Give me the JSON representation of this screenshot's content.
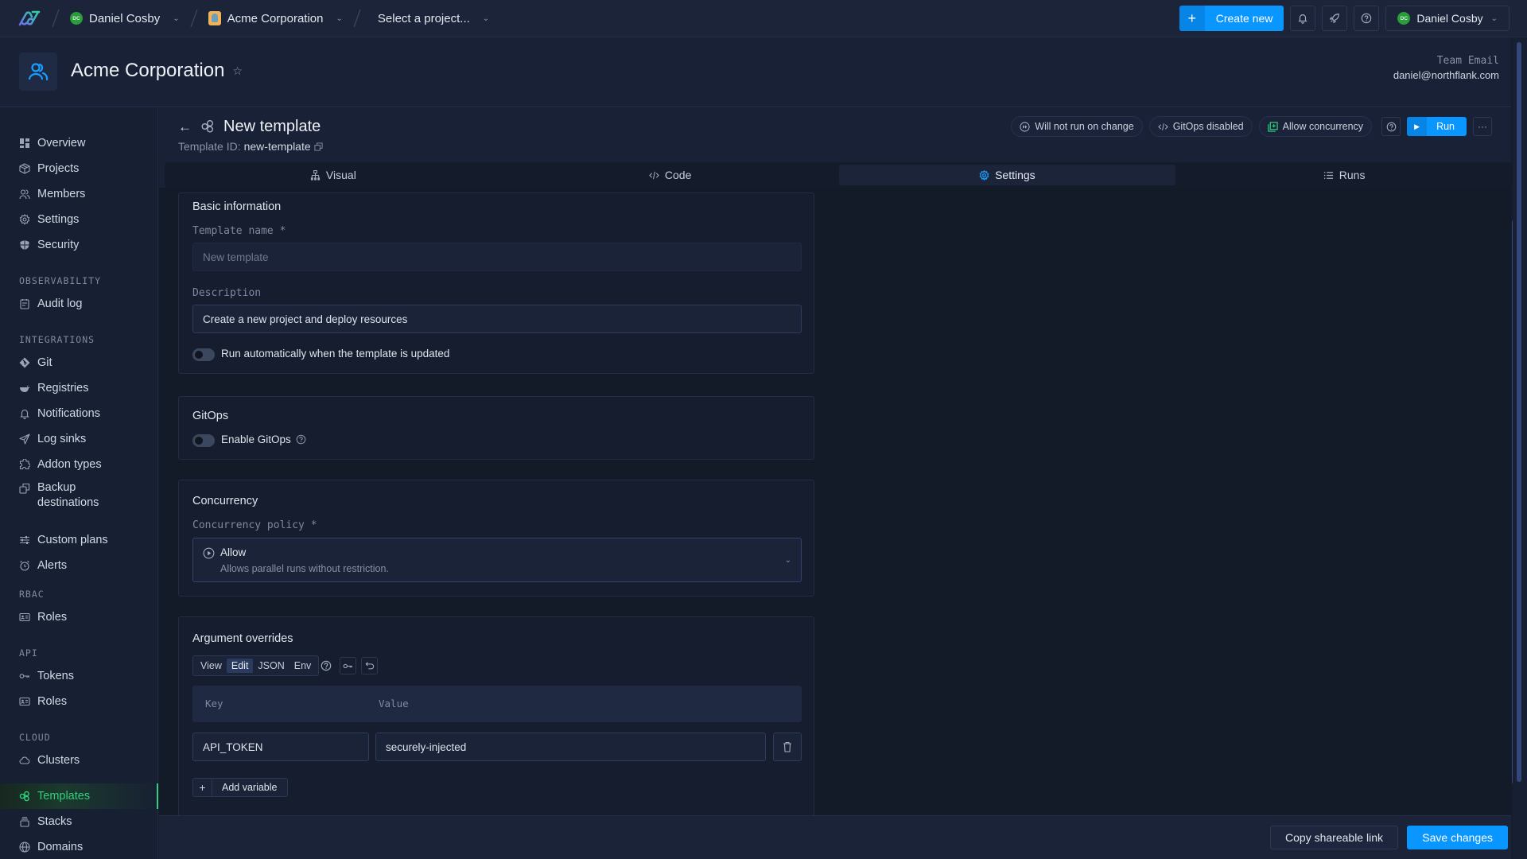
{
  "topbar": {
    "user_crumb": "Daniel Cosby",
    "user_initials": "DC",
    "org_crumb": "Acme Corporation",
    "project_crumb": "Select a project...",
    "create_new_label": "Create new",
    "user_menu_label": "Daniel Cosby"
  },
  "org_header": {
    "title": "Acme Corporation",
    "team_email_label": "Team Email",
    "team_email_value": "daniel@northflank.com"
  },
  "sidebar": {
    "items_top": [
      {
        "label": "Overview",
        "icon": "grid-icon"
      },
      {
        "label": "Projects",
        "icon": "cube-icon"
      },
      {
        "label": "Members",
        "icon": "users-icon"
      },
      {
        "label": "Settings",
        "icon": "gear-icon"
      },
      {
        "label": "Security",
        "icon": "shield-icon"
      }
    ],
    "sections": {
      "observability": "OBSERVABILITY",
      "integrations": "INTEGRATIONS",
      "rbac": "RBAC",
      "api": "API",
      "cloud": "CLOUD"
    },
    "observability": [
      {
        "label": "Audit log",
        "icon": "clipboard-icon"
      }
    ],
    "integrations": [
      {
        "label": "Git",
        "icon": "git-icon"
      },
      {
        "label": "Registries",
        "icon": "docker-icon"
      },
      {
        "label": "Notifications",
        "icon": "bell-icon"
      },
      {
        "label": "Log sinks",
        "icon": "send-icon"
      },
      {
        "label": "Addon types",
        "icon": "puzzle-icon"
      },
      {
        "label": "Backup destinations",
        "icon": "copy-icon"
      },
      {
        "label": "Custom plans",
        "icon": "sliders-icon"
      },
      {
        "label": "Alerts",
        "icon": "alarm-icon"
      }
    ],
    "rbac": [
      {
        "label": "Roles",
        "icon": "id-card-icon"
      }
    ],
    "api": [
      {
        "label": "Tokens",
        "icon": "key-icon"
      },
      {
        "label": "Roles",
        "icon": "id-card-icon"
      }
    ],
    "cloud": [
      {
        "label": "Clusters",
        "icon": "cloud-icon"
      }
    ],
    "bottom": [
      {
        "label": "Templates",
        "icon": "template-icon",
        "active": true
      },
      {
        "label": "Stacks",
        "icon": "stack-icon"
      },
      {
        "label": "Domains",
        "icon": "globe-icon"
      }
    ]
  },
  "template": {
    "title": "New template",
    "id_label": "Template ID:",
    "id_value": "new-template",
    "pills": {
      "run_on_change": "Will not run on change",
      "gitops": "GitOps disabled",
      "concurrency": "Allow concurrency"
    },
    "run_label": "Run",
    "tabs": [
      {
        "label": "Visual",
        "active": false
      },
      {
        "label": "Code",
        "active": false
      },
      {
        "label": "Settings",
        "active": true
      },
      {
        "label": "Runs",
        "active": false
      }
    ]
  },
  "basic_info": {
    "title": "Basic information",
    "name_label": "Template name *",
    "name_placeholder": "New template",
    "description_label": "Description",
    "description_value": "Create a new project and deploy resources",
    "auto_run_label": "Run automatically when the template is updated",
    "auto_run_enabled": false
  },
  "gitops": {
    "title": "GitOps",
    "enable_label": "Enable GitOps",
    "enabled": false
  },
  "concurrency": {
    "title": "Concurrency",
    "policy_label": "Concurrency policy *",
    "selected_name": "Allow",
    "selected_desc": "Allows parallel runs without restriction."
  },
  "argument_overrides": {
    "title": "Argument overrides",
    "modes": [
      "View",
      "Edit",
      "JSON",
      "Env"
    ],
    "active_mode": "Edit",
    "col_key": "Key",
    "col_value": "Value",
    "rows": [
      {
        "key": "API_TOKEN",
        "value": "securely-injected"
      }
    ],
    "add_label": "Add variable"
  },
  "footer": {
    "copy_link_label": "Copy shareable link",
    "save_label": "Save changes"
  },
  "colors": {
    "accent": "#0a96ff",
    "active_nav": "#2fd17e",
    "background": "#131a28"
  }
}
